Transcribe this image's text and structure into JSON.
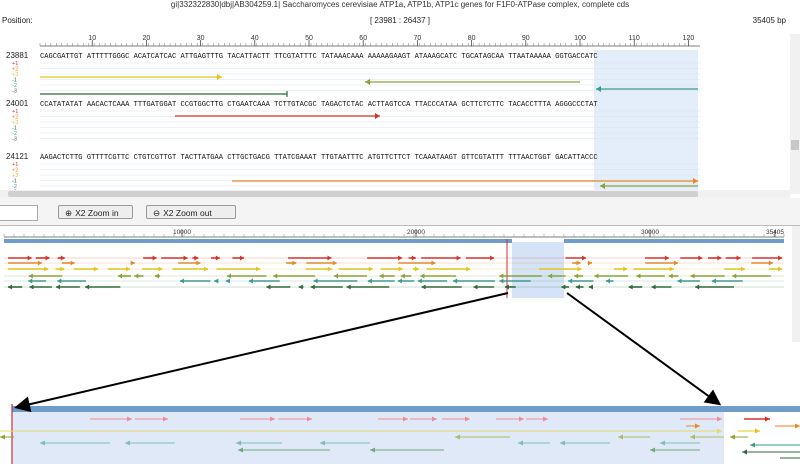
{
  "window": {
    "title": "gi|332322830|dbj|AB304259.1| Saccharomyces cerevisiae ATP1a, ATP1b, ATP1c genes for F1F0-ATPase complex, complete cds"
  },
  "position_bar": {
    "label": "Position:",
    "range": "[ 23981 : 26437 ]",
    "length": "35405 bp"
  },
  "ruler": {
    "ticks": [
      "10",
      "20",
      "30",
      "40",
      "50",
      "60",
      "70",
      "80",
      "90",
      "100",
      "110",
      "120"
    ]
  },
  "frame_labels": [
    "+1",
    "+2",
    "+3",
    "-1",
    "-2",
    "-3"
  ],
  "sequence_rows": [
    {
      "start": "23881",
      "seq": "CAGCGATTGT ATTTTTGGGC ACATCATCAC ATTGAGTTTG TACATTACTT TTCGTATTTC TATAAACAAA AAAAAGAAGT ATAAAGCATC TGCATAGCAA TTAATAAAAA GGTGACCATC"
    },
    {
      "start": "24001",
      "seq": "CCATATATAT AACACTCAAA TTTGATGGAT CCGTGGCTTG CTGAATCAAA TCTTGTACGC TAGACTCTAC ACTTAGTCCA TTACCCATAA GCTTCTCTTC TACACCTTTA AGGGCCCTAT"
    },
    {
      "start": "24121",
      "seq": "AAGACTCTTG GTTTTCGTTC CTGTCGTTGT TACTTATGAA CTTGCTGACG TTATCGAAAT TTGTAATTTC ATGTTCTTCT TCAAATAAGT GTTCGTATTT TTTAACTGGT GACATTACCC"
    }
  ],
  "toolbar": {
    "zoom_in_label": "X2 Zoom in",
    "zoom_out_label": "X2 Zoom out",
    "zoom_icon": "magnifier-icon"
  },
  "overview": {
    "ticks": [
      "10000",
      "20000",
      "30000",
      "35405"
    ]
  },
  "colors": {
    "red": "#d9302b",
    "orange": "#e8862a",
    "yellow": "#e6c41c",
    "olive": "#8aa334",
    "teal": "#3f9a8e",
    "darkgreen": "#2d6b3a",
    "selection": "#c9dcf3",
    "band": "#6f9cc9"
  }
}
